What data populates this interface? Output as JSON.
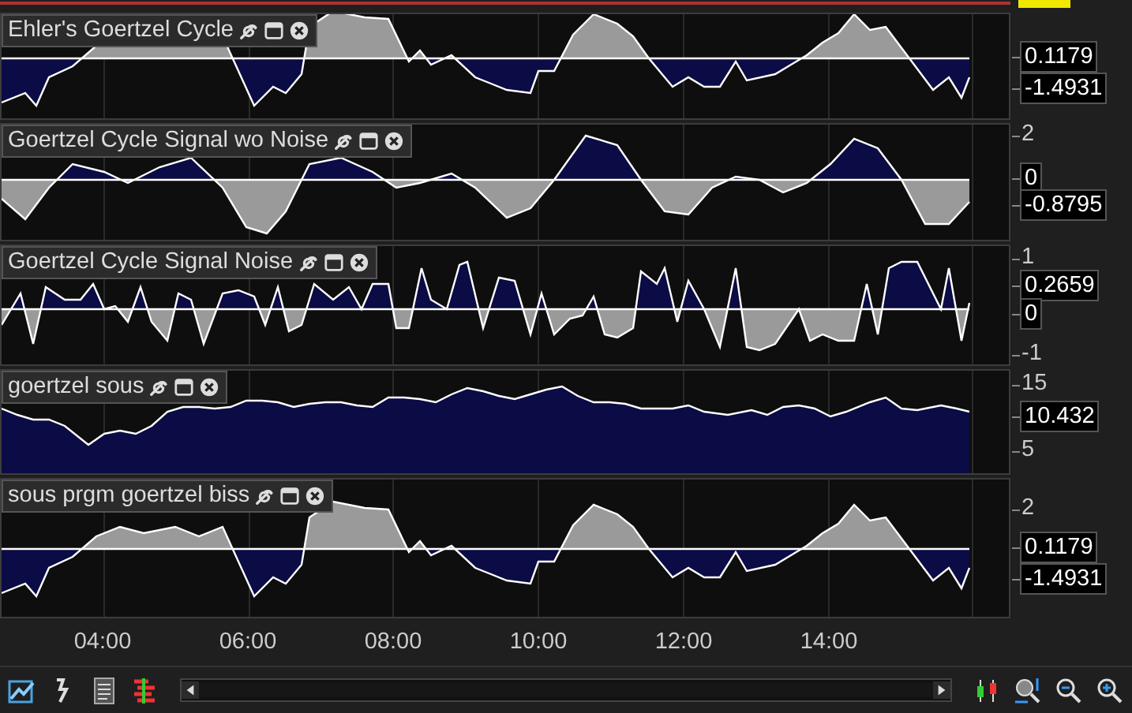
{
  "panes": [
    {
      "title": "Ehler's Goertzel Cycle",
      "kind": "oscillator",
      "axis_labels": [
        {
          "text": "0.1179",
          "kind": "value"
        },
        {
          "text": "-1.4931",
          "kind": "value"
        }
      ]
    },
    {
      "title": "Goertzel Cycle Signal wo Noise",
      "kind": "cycle",
      "axis_labels": [
        {
          "text": "2",
          "kind": "tick"
        },
        {
          "text": "0",
          "kind": "value"
        },
        {
          "text": "-0.8795",
          "kind": "value"
        }
      ]
    },
    {
      "title": "Goertzel Cycle Signal Noise",
      "kind": "cycle",
      "axis_labels": [
        {
          "text": "1",
          "kind": "tick"
        },
        {
          "text": "0.2659",
          "kind": "value"
        },
        {
          "text": "0",
          "kind": "value"
        },
        {
          "text": "-1",
          "kind": "tick"
        }
      ]
    },
    {
      "title": "goertzel sous",
      "kind": "area",
      "axis_labels": [
        {
          "text": "15",
          "kind": "tick"
        },
        {
          "text": "10.432",
          "kind": "value"
        },
        {
          "text": "5",
          "kind": "tick"
        }
      ]
    },
    {
      "title": "sous prgm goertzel biss",
      "kind": "oscillator",
      "axis_labels": [
        {
          "text": "2",
          "kind": "tick"
        },
        {
          "text": "0.1179",
          "kind": "value"
        },
        {
          "text": "-1.4931",
          "kind": "value"
        }
      ]
    }
  ],
  "time_axis": [
    "04:00",
    "06:00",
    "08:00",
    "10:00",
    "12:00",
    "14:00"
  ]
}
